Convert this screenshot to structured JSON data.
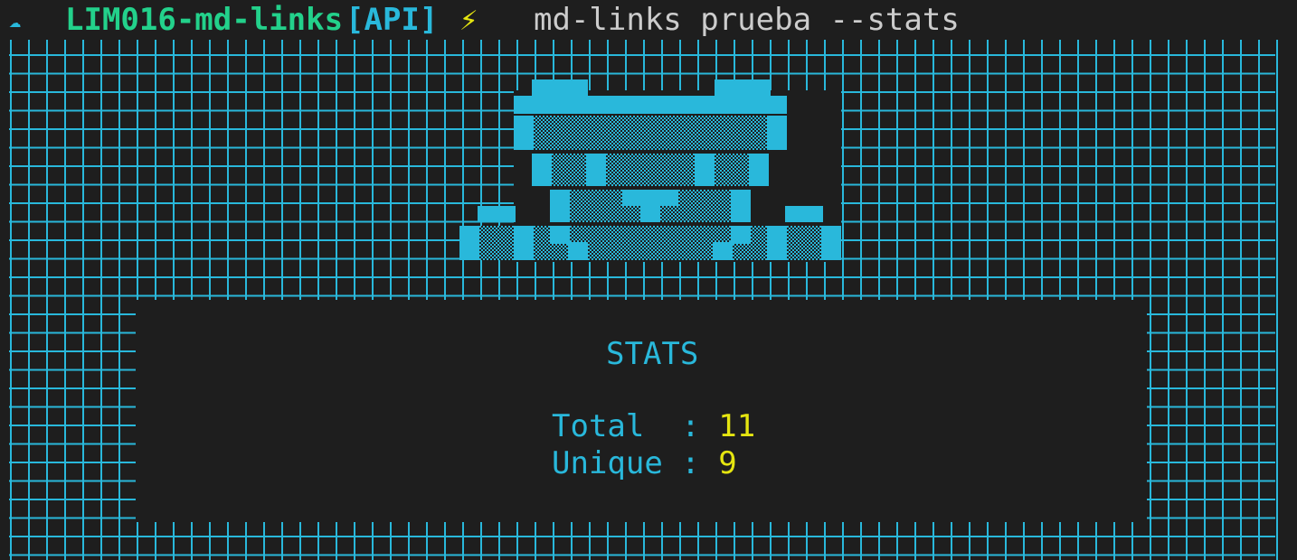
{
  "prompt": {
    "cloud_icon": "cloud-icon",
    "directory": "LIM016-md-links",
    "branch": "[API]",
    "bolt_glyph": "⚡",
    "command": "md-links prueba --stats"
  },
  "stats": {
    "title": "STATS",
    "total_label": "Total  : ",
    "total_value": "11",
    "unique_label": "Unique : ",
    "unique_value": "9"
  },
  "colors": {
    "background": "#1e1e1e",
    "cyan": "#29b8db",
    "green": "#23d18b",
    "yellow": "#e5e510",
    "command_text": "#cccccc"
  }
}
